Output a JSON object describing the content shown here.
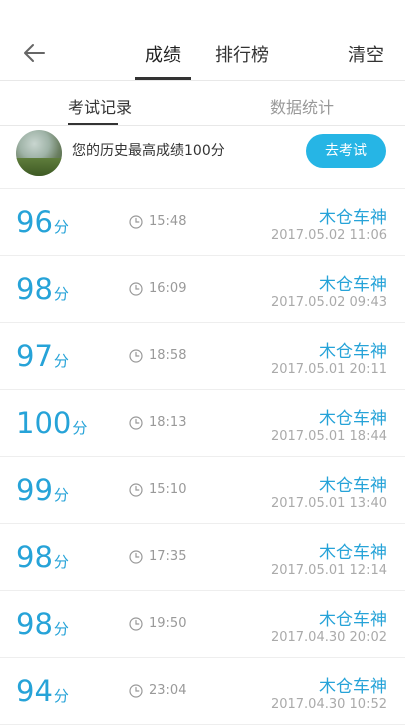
{
  "header": {
    "tabs": [
      "成绩",
      "排行榜"
    ],
    "clear_label": "清空"
  },
  "subtabs": [
    "考试记录",
    "数据统计"
  ],
  "banner": {
    "text": "您的历史最高成绩100分",
    "button_label": "去考试"
  },
  "score_unit": "分",
  "records": [
    {
      "score": "96",
      "time": "15:48",
      "coach": "木仓车神",
      "date": "2017.05.02  11:06"
    },
    {
      "score": "98",
      "time": "16:09",
      "coach": "木仓车神",
      "date": "2017.05.02  09:43"
    },
    {
      "score": "97",
      "time": "18:58",
      "coach": "木仓车神",
      "date": "2017.05.01  20:11"
    },
    {
      "score": "100",
      "time": "18:13",
      "coach": "木仓车神",
      "date": "2017.05.01  18:44"
    },
    {
      "score": "99",
      "time": "15:10",
      "coach": "木仓车神",
      "date": "2017.05.01  13:40"
    },
    {
      "score": "98",
      "time": "17:35",
      "coach": "木仓车神",
      "date": "2017.05.01  12:14"
    },
    {
      "score": "98",
      "time": "19:50",
      "coach": "木仓车神",
      "date": "2017.04.30  20:02"
    },
    {
      "score": "94",
      "time": "23:04",
      "coach": "木仓车神",
      "date": "2017.04.30  10:52"
    }
  ],
  "colors": {
    "accent": "#26b5e5",
    "score_text": "#26a3d8"
  },
  "icons": {
    "back": "arrow-left-icon",
    "clock": "clock-icon"
  }
}
